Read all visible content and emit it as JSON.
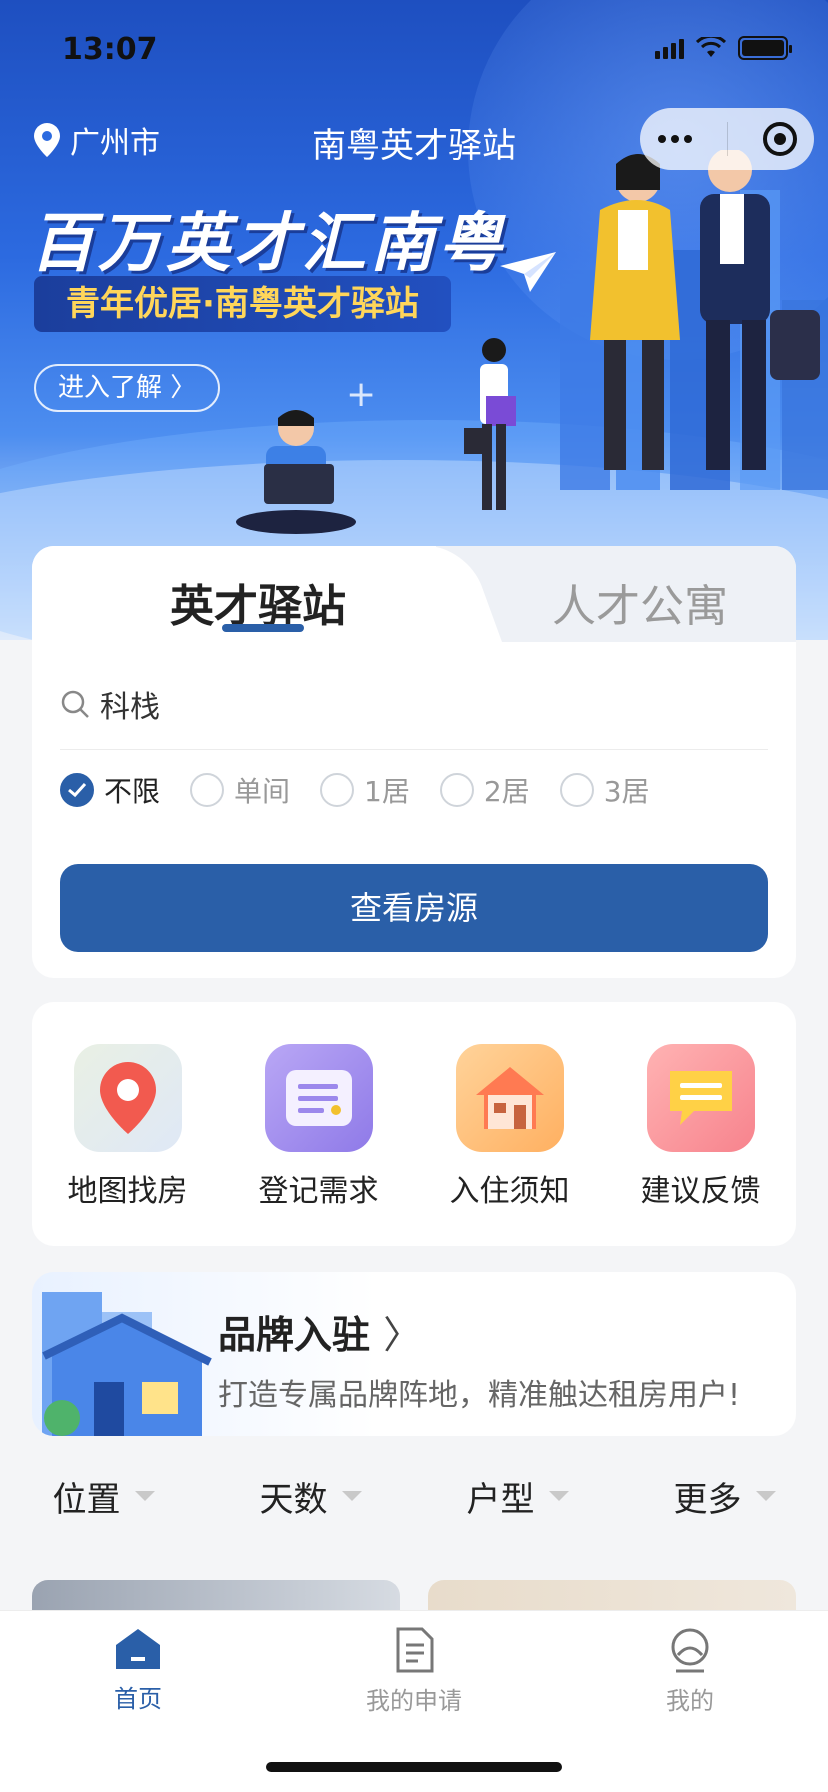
{
  "status_bar": {
    "time": "13:07"
  },
  "header": {
    "city": "广州市",
    "title": "南粤英才驿站"
  },
  "banner": {
    "headline": "百万英才汇南粤",
    "subheadline": "青年优居·南粤英才驿站",
    "cta": "进入了解 〉"
  },
  "search_card": {
    "tabs": [
      {
        "label": "英才驿站",
        "active": true
      },
      {
        "label": "人才公寓",
        "active": false
      }
    ],
    "search_value": "科栈",
    "room_types": [
      {
        "label": "不限",
        "checked": true
      },
      {
        "label": "单间",
        "checked": false
      },
      {
        "label": "1居",
        "checked": false
      },
      {
        "label": "2居",
        "checked": false
      },
      {
        "label": "3居",
        "checked": false
      }
    ],
    "submit": "查看房源"
  },
  "quick_actions": [
    {
      "label": "地图找房",
      "icon": "map-pin-icon"
    },
    {
      "label": "登记需求",
      "icon": "form-icon"
    },
    {
      "label": "入住须知",
      "icon": "house-icon"
    },
    {
      "label": "建议反馈",
      "icon": "chat-bubble-icon"
    }
  ],
  "brand_banner": {
    "title": "品牌入驻",
    "subtitle": "打造专属品牌阵地，精准触达租房用户!"
  },
  "filters": [
    "位置",
    "天数",
    "户型",
    "更多"
  ],
  "tabbar": [
    {
      "label": "首页",
      "icon": "home-icon",
      "active": true
    },
    {
      "label": "我的申请",
      "icon": "document-icon",
      "active": false
    },
    {
      "label": "我的",
      "icon": "profile-icon",
      "active": false
    }
  ],
  "colors": {
    "primary": "#2a5fa8",
    "hero": "#2c6ae0",
    "accent_yellow": "#ffd65a"
  }
}
